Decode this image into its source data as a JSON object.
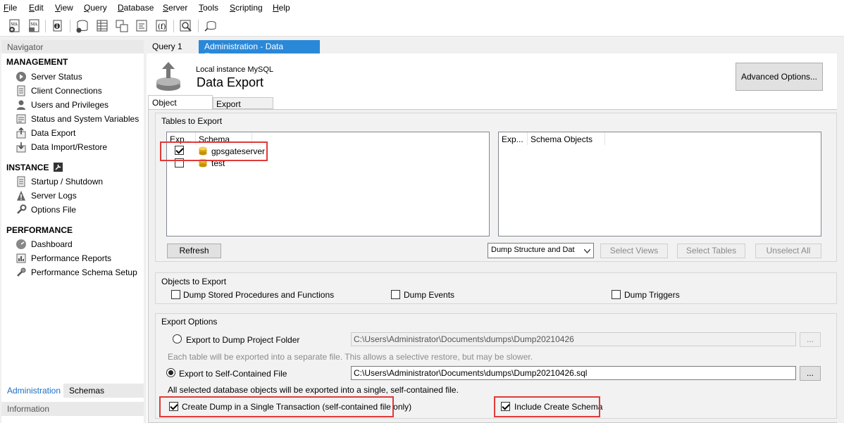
{
  "menu": [
    "File",
    "Edit",
    "View",
    "Query",
    "Database",
    "Server",
    "Tools",
    "Scripting",
    "Help"
  ],
  "navigator": {
    "title": "Navigator",
    "management": {
      "heading": "MANAGEMENT",
      "items": [
        "Server Status",
        "Client Connections",
        "Users and Privileges",
        "Status and System Variables",
        "Data Export",
        "Data Import/Restore"
      ]
    },
    "instance": {
      "heading": "INSTANCE",
      "items": [
        "Startup / Shutdown",
        "Server Logs",
        "Options File"
      ]
    },
    "performance": {
      "heading": "PERFORMANCE",
      "items": [
        "Dashboard",
        "Performance Reports",
        "Performance Schema Setup"
      ]
    },
    "tabs": [
      "Administration",
      "Schemas"
    ],
    "info_title": "Information"
  },
  "tabs": {
    "query": "Query 1",
    "admin": "Administration - Data Export",
    "close": "✕"
  },
  "header": {
    "instance": "Local instance MySQL",
    "title": "Data Export",
    "advanced_button": "Advanced Options..."
  },
  "subtabs": [
    "Object Selection",
    "Export Progress"
  ],
  "tables_to_export": {
    "title": "Tables to Export",
    "left_columns": [
      "Exp...",
      "Schema"
    ],
    "schemas": [
      {
        "name": "gpsgateserver",
        "checked": true
      },
      {
        "name": "test",
        "checked": false
      }
    ],
    "right_columns": [
      "Exp...",
      "Schema Objects"
    ],
    "refresh": "Refresh",
    "dump_mode": "Dump Structure and Dat",
    "select_views": "Select Views",
    "select_tables": "Select Tables",
    "unselect_all": "Unselect All"
  },
  "objects_to_export": {
    "title": "Objects to Export",
    "stored_procedures": "Dump Stored Procedures and Functions",
    "events": "Dump Events",
    "triggers": "Dump Triggers"
  },
  "export_options": {
    "title": "Export Options",
    "project_folder_label": "Export to Dump Project Folder",
    "project_folder_path": "C:\\Users\\Administrator\\Documents\\dumps\\Dump20210426",
    "project_folder_hint": "Each table will be exported into a separate file. This allows a selective restore, but may be slower.",
    "self_contained_label": "Export to Self-Contained File",
    "self_contained_path": "C:\\Users\\Administrator\\Documents\\dumps\\Dump20210426.sql",
    "self_contained_hint": "All selected database objects will be exported into a single, self-contained file.",
    "browse": "...",
    "single_transaction": "Create Dump in a Single Transaction (self-contained file only)",
    "include_schema": "Include Create Schema"
  },
  "colors": {
    "accent_tab": "#2a88d8",
    "highlight": "#e03a3a"
  }
}
